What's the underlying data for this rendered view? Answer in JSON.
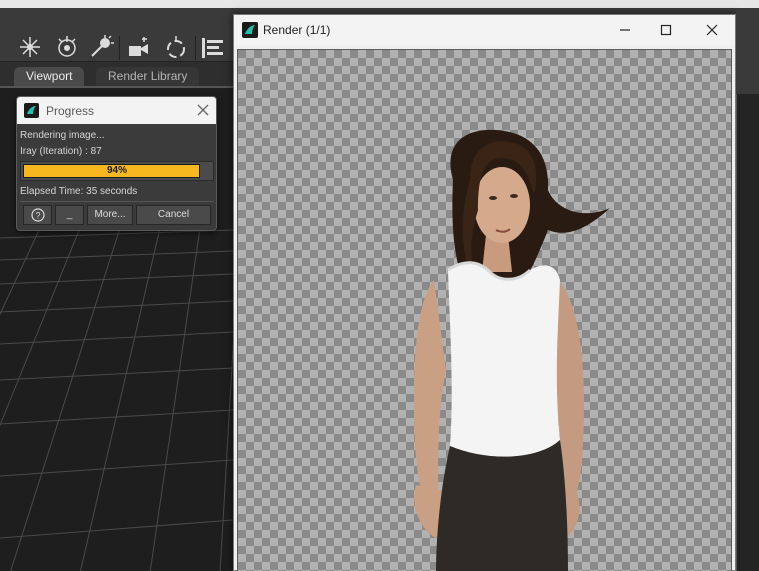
{
  "viewport_tabs": [
    {
      "label": "Viewport",
      "active": true
    },
    {
      "label": "Render Library",
      "active": false
    }
  ],
  "toolbar": {
    "icons": [
      "sparkle-tool-icon",
      "joint-tool-icon",
      "pin-tool-icon",
      "camera-tool-icon",
      "rotate-tool-icon",
      "align-icon"
    ]
  },
  "progress_dialog": {
    "title": "Progress",
    "status": "Rendering image...",
    "iteration": "Iray (Iteration) : 87",
    "percent_label": "94%",
    "percent_value": 0.94,
    "elapsed": "Elapsed Time: 35 seconds",
    "buttons": {
      "help": "?",
      "minimize": "_",
      "more": "More...",
      "cancel": "Cancel"
    }
  },
  "render_window": {
    "title": "Render (1/1)",
    "controls": [
      "minimize",
      "maximize",
      "close"
    ]
  },
  "colors": {
    "progress_fill": "#f6b81e",
    "app_bg": "#2b2b2b",
    "brand_icon": "#1a9f8f"
  }
}
